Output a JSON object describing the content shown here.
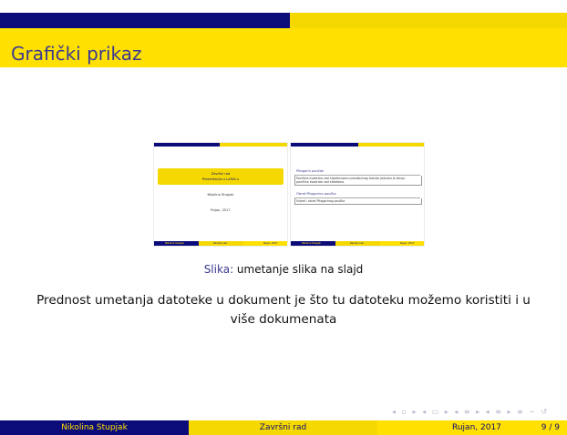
{
  "slide": {
    "title": "Grafički prikaz",
    "caption_label": "Slika:",
    "caption_text": " umetanje slika na slajd",
    "paragraph": "Prednost umetanja datoteke u dokument je što tu datoteku možemo koristiti i u više dokumenata"
  },
  "thumb1": {
    "title": "Završni rad",
    "subtitle": "Prezentacija u LaTeX-u",
    "author": "Nikolina Stupjak",
    "date": "Rujan, 2017",
    "foot_left": "Nikolina Stupjak",
    "foot_mid": "Završni rad",
    "foot_right": "Rujan, 2017"
  },
  "thumb2": {
    "block1_title": "Pitagorin poučak",
    "block1_text": "Površina kvadrata nad hipotenuzom pravokutnog trokuta jednaka je zbroju površina kvadrata nad katetama.",
    "block2_title": "Obrat Pitagorina poučka",
    "block2_text": "Vrijedi i obrat Pitagorinog poučka",
    "foot_left": "Nikolina Stupjak",
    "foot_mid": "Završni rad",
    "foot_right": "Rujan, 2017"
  },
  "nav_symbols": "◂ ▫ ▸ ◂ ▭ ▸ ◂ ≡ ▸ ◂ ≡ ▸ ≡ ∽ ↺",
  "footer": {
    "author": "Nikolina Stupjak",
    "title": "Završni rad",
    "date": "Rujan, 2017",
    "page": "9 / 9"
  },
  "colors": {
    "navy": "#0b0b7a",
    "yellow": "#ffe000",
    "title_text": "#3a3a90"
  }
}
